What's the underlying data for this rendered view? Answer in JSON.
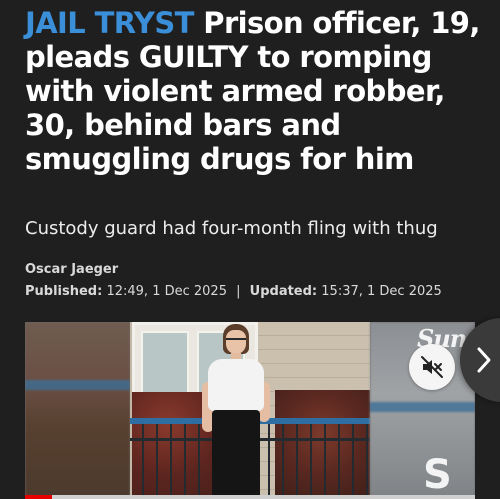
{
  "article": {
    "kicker": "JAIL TRYST",
    "headline": "Prison officer, 19, pleads GUILTY to romping with violent armed robber, 30, behind bars and smuggling drugs for him",
    "standfirst": "Custody guard had four-month fling with thug",
    "author": "Oscar Jaeger",
    "published_label": "Published:",
    "published_value": "12:49, 1 Dec 2025",
    "separator": "|",
    "updated_label": "Updated:",
    "updated_value": "15:37, 1 Dec 2025"
  },
  "video": {
    "brand_watermark_top": "Sun",
    "brand_watermark_bottom": "S",
    "progress": 0.06,
    "icons": {
      "mute": "speaker-muted-icon",
      "next": "chevron-right-icon"
    }
  },
  "colors": {
    "background": "#1f1f1f",
    "kicker": "#3b8fd8",
    "progress": "#e60000"
  }
}
